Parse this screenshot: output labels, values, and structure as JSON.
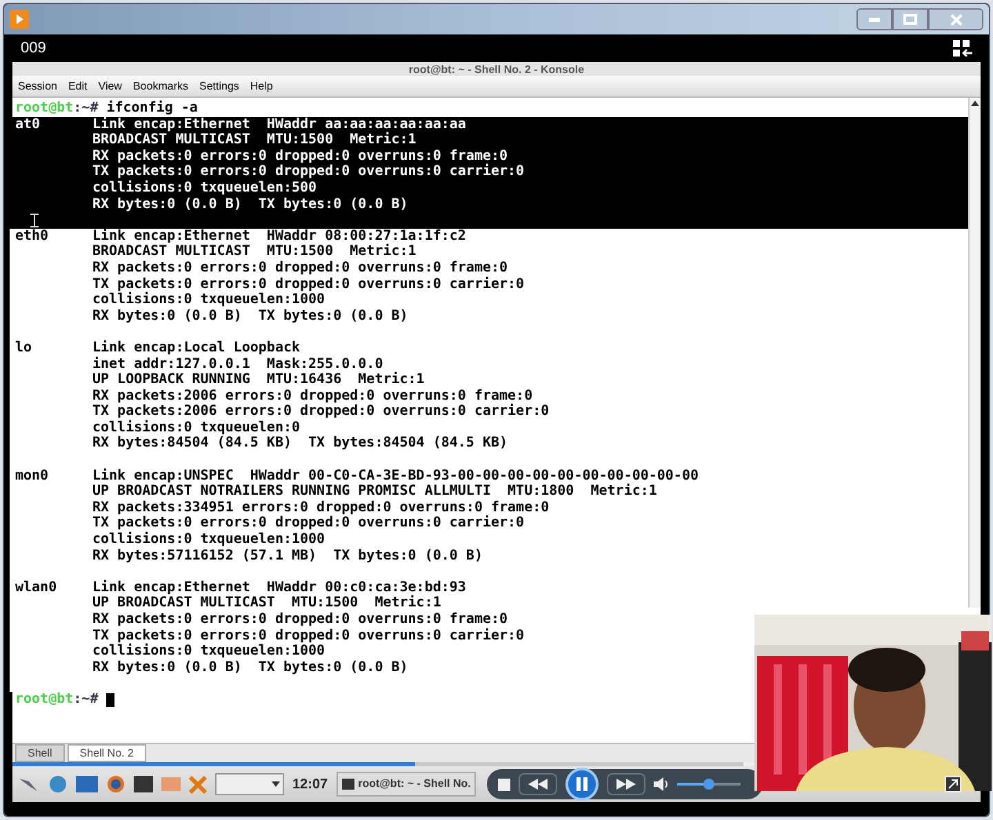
{
  "player": {
    "window_number": "009",
    "time": "12:07",
    "playing": true,
    "progress": {
      "level": 0.55
    },
    "volume": {
      "level": 0.5
    }
  },
  "konsole": {
    "title": "root@bt: ~ - Shell No. 2 - Konsole",
    "menu": [
      "Session",
      "Edit",
      "View",
      "Bookmarks",
      "Settings",
      "Help"
    ],
    "command": {
      "user": "root@bt",
      "tail": ":~#",
      "text": "ifconfig -a"
    },
    "interfaces": [
      {
        "name": "at0",
        "selected": true,
        "lines": [
          "Link encap:Ethernet  HWaddr aa:aa:aa:aa:aa:aa",
          "BROADCAST MULTICAST  MTU:1500  Metric:1",
          "RX packets:0 errors:0 dropped:0 overruns:0 frame:0",
          "TX packets:0 errors:0 dropped:0 overruns:0 carrier:0",
          "collisions:0 txqueuelen:500",
          "RX bytes:0 (0.0 B)  TX bytes:0 (0.0 B)"
        ]
      },
      {
        "name": "eth0",
        "selected": false,
        "lines": [
          "Link encap:Ethernet  HWaddr 08:00:27:1a:1f:c2",
          "BROADCAST MULTICAST  MTU:1500  Metric:1",
          "RX packets:0 errors:0 dropped:0 overruns:0 frame:0",
          "TX packets:0 errors:0 dropped:0 overruns:0 carrier:0",
          "collisions:0 txqueuelen:1000",
          "RX bytes:0 (0.0 B)  TX bytes:0 (0.0 B)"
        ]
      },
      {
        "name": "lo",
        "selected": false,
        "lines": [
          "Link encap:Local Loopback",
          "inet addr:127.0.0.1  Mask:255.0.0.0",
          "UP LOOPBACK RUNNING  MTU:16436  Metric:1",
          "RX packets:2006 errors:0 dropped:0 overruns:0 frame:0",
          "TX packets:2006 errors:0 dropped:0 overruns:0 carrier:0",
          "collisions:0 txqueuelen:0",
          "RX bytes:84504 (84.5 KB)  TX bytes:84504 (84.5 KB)"
        ]
      },
      {
        "name": "mon0",
        "selected": false,
        "lines": [
          "Link encap:UNSPEC  HWaddr 00-C0-CA-3E-BD-93-00-00-00-00-00-00-00-00-00-00",
          "UP BROADCAST NOTRAILERS RUNNING PROMISC ALLMULTI  MTU:1800  Metric:1",
          "RX packets:334951 errors:0 dropped:0 overruns:0 frame:0",
          "TX packets:0 errors:0 dropped:0 overruns:0 carrier:0",
          "collisions:0 txqueuelen:1000",
          "RX bytes:57116152 (57.1 MB)  TX bytes:0 (0.0 B)"
        ]
      },
      {
        "name": "wlan0",
        "selected": false,
        "lines": [
          "Link encap:Ethernet  HWaddr 00:c0:ca:3e:bd:93",
          "UP BROADCAST MULTICAST  MTU:1500  Metric:1",
          "RX packets:0 errors:0 dropped:0 overruns:0 frame:0",
          "TX packets:0 errors:0 dropped:0 overruns:0 carrier:0",
          "collisions:0 txqueuelen:1000",
          "RX bytes:0 (0.0 B)  TX bytes:0 (0.0 B)"
        ]
      }
    ],
    "prompt": {
      "user": "root@bt",
      "tail": ":~#"
    },
    "tabs": [
      {
        "label": "Shell",
        "selected": false
      },
      {
        "label": "Shell No. 2",
        "selected": true
      }
    ]
  },
  "taskbar": {
    "task": "root@bt: ~ - Shell No."
  }
}
